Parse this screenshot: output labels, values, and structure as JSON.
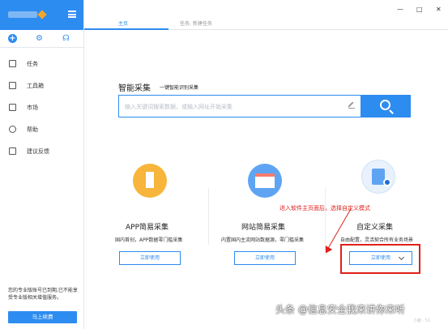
{
  "sidebar": {
    "nav": [
      {
        "label": "任务",
        "icon": "document-icon"
      },
      {
        "label": "工具箱",
        "icon": "toolbox-icon"
      },
      {
        "label": "市场",
        "icon": "store-icon"
      },
      {
        "label": "帮助",
        "icon": "help-icon"
      },
      {
        "label": "建议反馈",
        "icon": "feedback-icon"
      }
    ],
    "notice": "您的专业版账号已到期,已不能享受专业版相关增值服务。",
    "renew_label": "马上续费"
  },
  "tabs": [
    "主页",
    "任务: 新建任务"
  ],
  "window_controls": [
    "—",
    "□",
    "✕"
  ],
  "search": {
    "title": "智能采集",
    "subtitle": "一键智能识别采集",
    "placeholder": "输入关键词搜索数据，或输入网址开始采集"
  },
  "cards": [
    {
      "title": "APP简易采集",
      "desc": "国内首创，APP数据零门槛采集",
      "button": "立即使用"
    },
    {
      "title": "网站简易采集",
      "desc": "内置国内主流网站数据源，零门槛采集",
      "button": "立即使用"
    },
    {
      "title": "自定义采集",
      "desc": "自由配置，灵活契合所有业务场景",
      "button": "立即使用"
    }
  ],
  "annotation": "进入软件主页面后，选择自定义模式",
  "watermark": "头条 @信息安全我来讲你来听",
  "watermark_small": "小鹿 · 51",
  "colors": {
    "accent": "#2d8cf0",
    "annotation": "#e0201b"
  }
}
